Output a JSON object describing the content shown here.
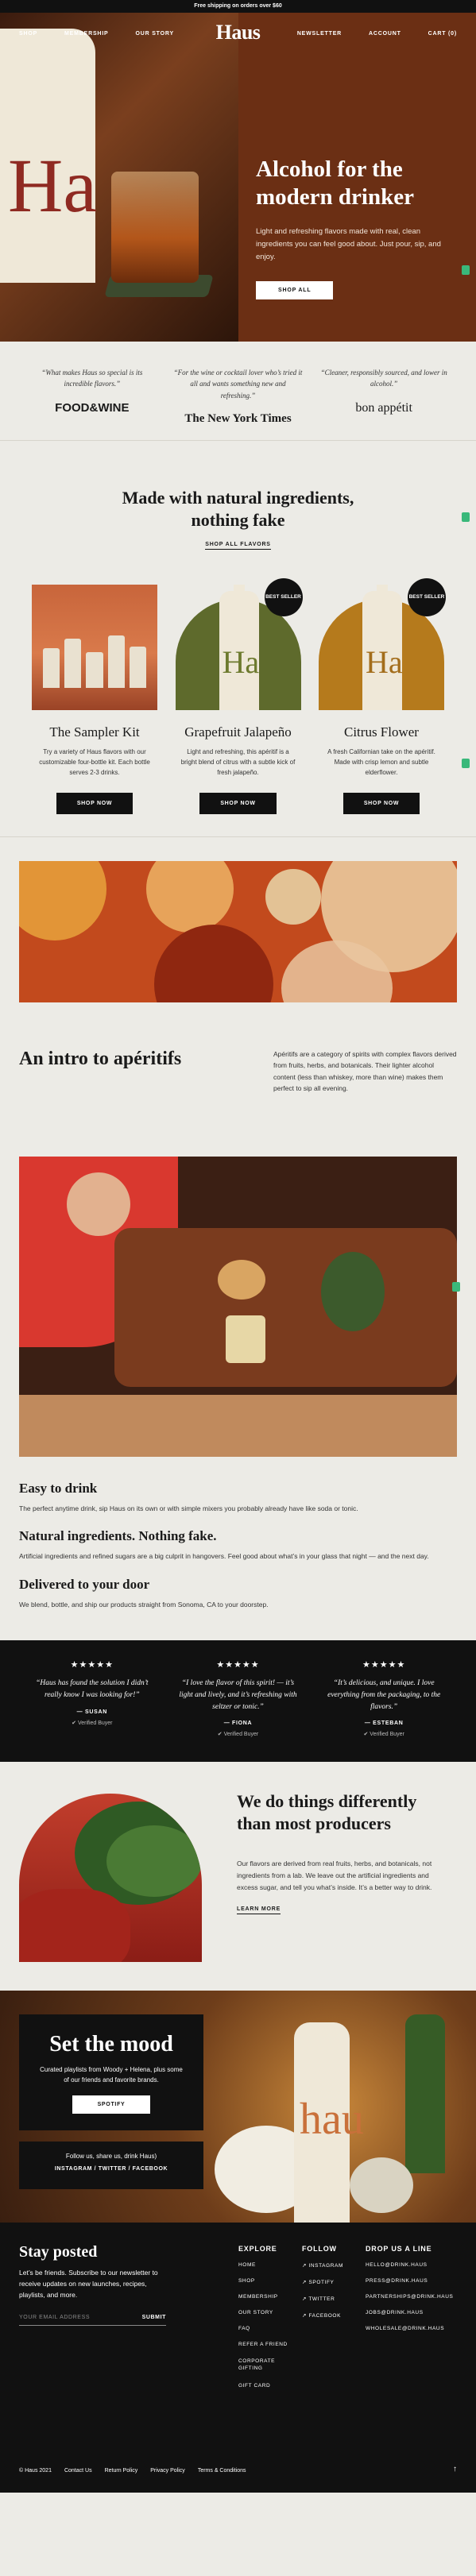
{
  "announce": "Free shipping on orders over $60",
  "nav": {
    "logo": "Haus",
    "left": [
      "SHOP",
      "MEMBERSHIP",
      "OUR STORY"
    ],
    "right": [
      "NEWSLETTER",
      "ACCOUNT",
      "CART (0)"
    ]
  },
  "hero": {
    "title": "Alcohol for the modern drinker",
    "subtitle": "Light and refreshing flavors made with real, clean ingredients you can feel good about. Just pour, sip, and enjoy.",
    "cta": "SHOP ALL",
    "bottle_text": "Ha"
  },
  "press": [
    {
      "quote": "“What makes Haus so special is its incredible flavors.”",
      "logo": "FOOD&WINE"
    },
    {
      "quote": "“For the wine or cocktail lover who’s tried it all and wants something new and refreshing.”",
      "logo": "The New York Times"
    },
    {
      "quote": "“Cleaner, responsibly sourced, and lower in alcohol.”",
      "logo": "bon appétit"
    }
  ],
  "products": {
    "title": "Made with natural ingredients, nothing fake",
    "link": "SHOP ALL FLAVORS",
    "items": [
      {
        "name": "The Sampler Kit",
        "desc": "Try a variety of Haus flavors with our customizable four-bottle kit. Each bottle serves 2-3 drinks.",
        "button": "SHOP NOW",
        "badge": ""
      },
      {
        "name": "Grapefruit Jalapeño",
        "desc": "Light and refreshing, this apéritif is a bright blend of citrus with a subtle kick of fresh jalapeño.",
        "button": "SHOP NOW",
        "badge": "BEST SELLER",
        "bottle_text": "Ha"
      },
      {
        "name": "Citrus Flower",
        "desc": "A fresh Californian take on the apéritif. Made with crisp lemon and subtle elderflower.",
        "button": "SHOP NOW",
        "badge": "BEST SELLER",
        "bottle_text": "Ha"
      }
    ]
  },
  "intro": {
    "title": "An intro to apéritifs",
    "text": "Apéritifs are a category of spirits with complex flavors derived from fruits, herbs, and botanicals. Their lighter alcohol content (less than whiskey, more than wine) makes them perfect to sip all evening."
  },
  "life": {
    "blocks": [
      {
        "title": "Easy to drink",
        "body": "The perfect anytime drink, sip Haus on its own or with simple mixers you probably already have like soda or tonic."
      },
      {
        "title": "Natural ingredients. Nothing fake.",
        "body": "Artificial ingredients and refined sugars are a big culprit in hangovers. Feel good about what’s in your glass that night — and the next day."
      },
      {
        "title": "Delivered to your door",
        "body": "We blend, bottle, and ship our products straight from Sonoma, CA to your doorstep."
      }
    ]
  },
  "reviews": [
    {
      "stars": "★★★★★",
      "text": "“Haus has found the solution I didn’t really know I was looking for!”",
      "name": "— SUSAN",
      "verified": "Verified Buyer"
    },
    {
      "stars": "★★★★★",
      "text": "“I love the flavor of this spirit! — it’s light and lively, and it’s refreshing with seltzer or tonic.”",
      "name": "— FIONA",
      "verified": "Verified Buyer"
    },
    {
      "stars": "★★★★★",
      "text": "“It’s delicious, and unique. I love everything from the packaging, to the flavors.”",
      "name": "— ESTEBAN",
      "verified": "Verified Buyer"
    }
  ],
  "different": {
    "title": "We do things differently than most producers",
    "body": "Our flavors are derived from real fruits, herbs, and botanicals, not ingredients from a lab. We leave out the artificial ingredients and excess sugar, and tell you what’s inside. It’s a better way to drink.",
    "link": "LEARN MORE"
  },
  "mood": {
    "title": "Set the mood",
    "sub": "Curated playlists from Woody + Helena, plus some of our friends and favorite brands.",
    "button": "SPOTIFY",
    "follow": "Follow us, share us, drink Haus)",
    "social": "INSTAGRAM / TWITTER / FACEBOOK",
    "bottle_text": "hau"
  },
  "footer": {
    "title": "Stay posted",
    "text": "Let’s be friends. Subscribe to our newsletter to receive updates on new launches, recipes, playlists, and more.",
    "email_placeholder": "YOUR EMAIL ADDRESS",
    "submit": "SUBMIT",
    "explore": {
      "heading": "EXPLORE",
      "items": [
        "HOME",
        "SHOP",
        "MEMBERSHIP",
        "OUR STORY",
        "FAQ",
        "REFER A FRIEND",
        "CORPORATE GIFTING",
        "GIFT CARD"
      ]
    },
    "follow": {
      "heading": "FOLLOW",
      "items": [
        "↗ INSTAGRAM",
        "↗ SPOTIFY",
        "↗ TWITTER",
        "↗ FACEBOOK"
      ]
    },
    "drop": {
      "heading": "DROP US A LINE",
      "items": [
        "HELLO@DRINK.HAUS",
        "PRESS@DRINK.HAUS",
        "PARTNERSHIPS@DRINK.HAUS",
        "JOBS@DRINK.HAUS",
        "WHOLESALE@DRINK.HAUS"
      ]
    },
    "bottom": [
      "© Haus 2021",
      "Contact Us",
      "Return Policy",
      "Privacy Policy",
      "Terms & Conditions"
    ],
    "arrow": "↑"
  }
}
